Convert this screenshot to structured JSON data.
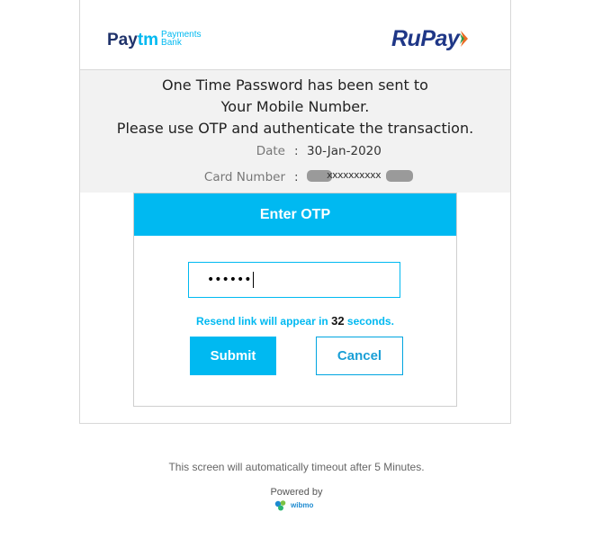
{
  "header": {
    "paytm_logo": {
      "part1": "Pay",
      "part2": "tm",
      "sub1": "Payments",
      "sub2": "Bank",
      "color_dark": "#20336b",
      "color_light": "#00b9f1"
    },
    "rupay_logo": {
      "text": "RuPay",
      "color": "#1f3787"
    }
  },
  "info": {
    "message_line1": "One Time Password has been sent to",
    "message_line2": "Your Mobile Number.",
    "message_line3": "Please use OTP and authenticate the transaction.",
    "date_label": "Date",
    "date_value": "30-Jan-2020",
    "card_label": "Card Number",
    "card_value": "xxxxxxxxxx",
    "separator": ":"
  },
  "otp": {
    "title": "Enter OTP",
    "input_value": "••••••",
    "resend_prefix": "Resend link will appear in",
    "resend_count": "32",
    "resend_suffix": "seconds.",
    "submit_label": "Submit",
    "cancel_label": "Cancel",
    "accent_color": "#00b9f1"
  },
  "footer": {
    "timeout_text": "This screen will automatically timeout after 5 Minutes.",
    "powered_by": "Powered by",
    "brand": "wibmo"
  }
}
